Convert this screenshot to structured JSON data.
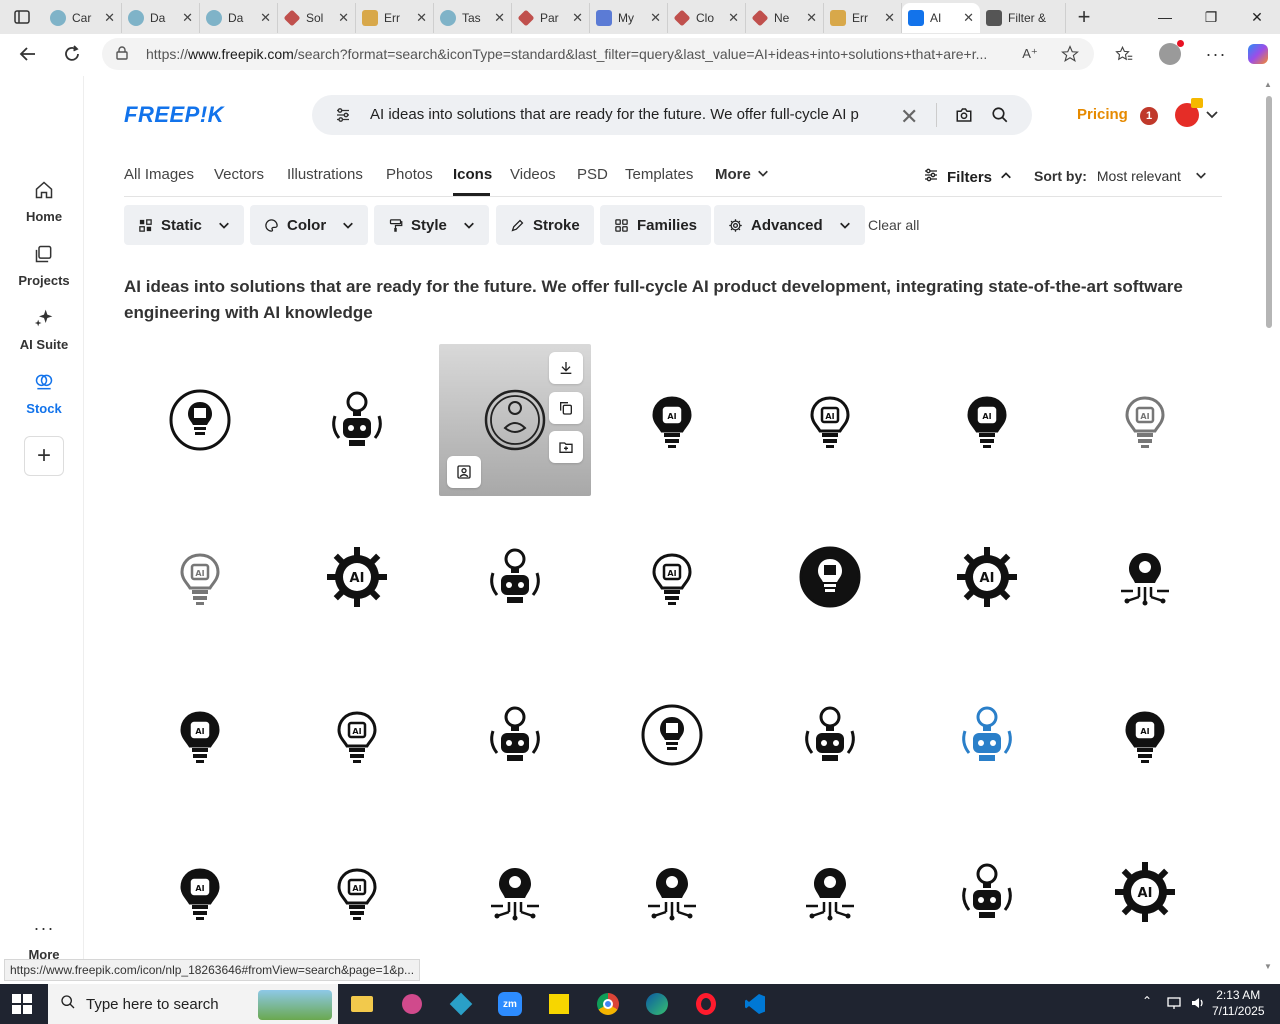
{
  "browser": {
    "tabs": [
      {
        "title": "Car",
        "icon": "circle-favicon",
        "color": "#7fb3c8"
      },
      {
        "title": "Da",
        "icon": "circle-favicon",
        "color": "#7fb3c8"
      },
      {
        "title": "Da",
        "icon": "circle-favicon",
        "color": "#7fb3c8"
      },
      {
        "title": "Sol",
        "icon": "diamond-favicon",
        "color": "#c0504d"
      },
      {
        "title": "Err",
        "icon": "w-favicon",
        "color": "#d8a84a"
      },
      {
        "title": "Tas",
        "icon": "circle-favicon",
        "color": "#7fb3c8"
      },
      {
        "title": "Par",
        "icon": "diamond-favicon",
        "color": "#c0504d"
      },
      {
        "title": "My",
        "icon": "doc-favicon",
        "color": "#5b7bd5"
      },
      {
        "title": "Clo",
        "icon": "diamond-favicon",
        "color": "#c0504d"
      },
      {
        "title": "Ne",
        "icon": "diamond-favicon",
        "color": "#c0504d"
      },
      {
        "title": "Err",
        "icon": "w-favicon",
        "color": "#d8a84a"
      },
      {
        "title": "AI",
        "icon": "freepik-favicon",
        "color": "#1273eb",
        "active": true
      },
      {
        "title": "Filter &",
        "icon": "wordpress-favicon",
        "color": "#555555"
      }
    ],
    "url_prefix": "https://",
    "url_host": "www.freepik.com",
    "url_rest": "/search?format=search&iconType=standard&last_filter=query&last_value=AI+ideas+into+solutions+that+are+r...",
    "status_url": "https://www.freepik.com/icon/nlp_18263646#fromView=search&page=1&p..."
  },
  "sidebar": {
    "items": [
      {
        "label": "Home",
        "icon": "home-icon"
      },
      {
        "label": "Projects",
        "icon": "projects-icon"
      },
      {
        "label": "AI Suite",
        "icon": "sparkle-icon"
      },
      {
        "label": "Stock",
        "icon": "stock-icon",
        "active": true
      }
    ],
    "more_label": "More"
  },
  "header": {
    "logo": "FREEP!K",
    "search_query": "AI ideas into solutions that are ready for the future. We offer full-cycle AI p",
    "pricing_label": "Pricing",
    "notification_count": "1"
  },
  "categories": [
    {
      "label": "All Images"
    },
    {
      "label": "Vectors"
    },
    {
      "label": "Illustrations"
    },
    {
      "label": "Photos"
    },
    {
      "label": "Icons",
      "active": true
    },
    {
      "label": "Videos"
    },
    {
      "label": "PSD"
    },
    {
      "label": "Templates"
    },
    {
      "label": "More"
    }
  ],
  "filters_toggle": "Filters",
  "sort": {
    "label": "Sort by:",
    "value": "Most relevant"
  },
  "filter_buttons": [
    {
      "label": "Static",
      "icon": "static-icon",
      "dropdown": true
    },
    {
      "label": "Color",
      "icon": "palette-icon",
      "dropdown": true
    },
    {
      "label": "Style",
      "icon": "brush-icon",
      "dropdown": true
    },
    {
      "label": "Stroke",
      "icon": "pen-icon",
      "dropdown": false
    },
    {
      "label": "Families",
      "icon": "grid-icon",
      "dropdown": false
    },
    {
      "label": "Advanced",
      "icon": "gear-icon",
      "dropdown": true
    }
  ],
  "clear_all": "Clear all",
  "heading": "AI ideas into solutions that are ready for the future. We offer full-cycle AI product development, integrating state-of-the-art software engineering with AI knowledge",
  "results": {
    "hovered_index": 2,
    "icons": [
      "ai-chip-bulb-circle-icon",
      "robot-bulb-icon",
      "brain-gear-circle-icon",
      "ai-bulb-icon",
      "ai-plant-bulb-icon",
      "chip-bulb-icon",
      "ai-bulb-outline-icon",
      "ai-gear-bulb-outline-icon",
      "brain-gear-bulb-icon",
      "brain-chip-icon",
      "brain-bulb-refresh-icon",
      "ai-bulb-dark-circle-icon",
      "ai-gear-icon",
      "brain-circuit-arrow-icon",
      "ai-gear-bulb-icon",
      "ai-chip-bulb-outline-icon",
      "robot-head-bulb-icon",
      "ai-circle-icon",
      "robot-bulb-circle-icon",
      "robot-bulb-color-icon",
      "ai-head-bulb-icon",
      "ai-chip-bulb-rays-icon",
      "brain-bulb-cycle-icon",
      "bulb-circuit-icon",
      "bulb-network-icon",
      "brain-bulb-circuit-icon",
      "gear-cloud-icon",
      "ai-bulb-gear-dark-icon"
    ]
  },
  "taskbar": {
    "search_placeholder": "Type here to search",
    "time": "2:13 AM",
    "date": "7/11/2025"
  }
}
